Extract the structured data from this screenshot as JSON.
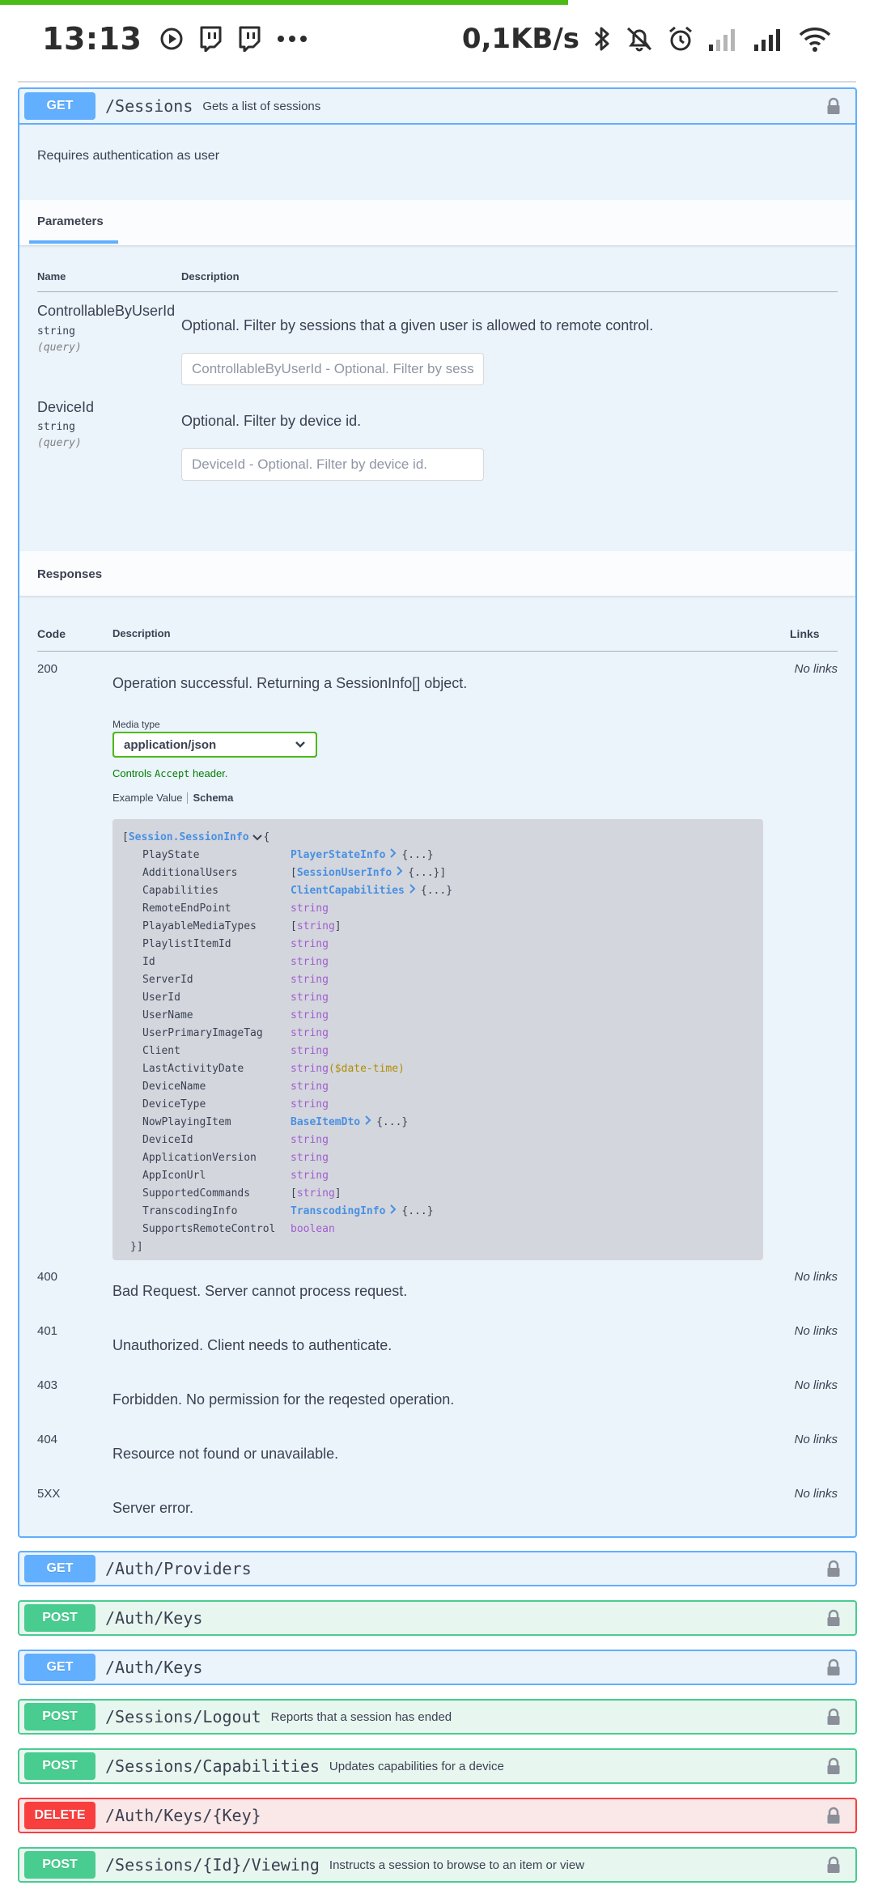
{
  "status_bar": {
    "time": "13:13",
    "net_speed": "0,1KB/s",
    "left_icons": [
      "record-icon",
      "twitch-icon",
      "twitch-icon",
      "more-dots-icon"
    ],
    "right_icons": [
      "bluetooth-icon",
      "muted-bell-icon",
      "alarm-icon",
      "signal-weak-icon",
      "signal-full-icon",
      "wifi-icon"
    ],
    "progress_fraction": 0.65,
    "progress_color": "#4cbb17"
  },
  "colors": {
    "get": "#61affe",
    "post": "#49cc90",
    "delete": "#f93e3e"
  },
  "operation": {
    "method": "GET",
    "path": "/Sessions",
    "summary": "Gets a list of sessions",
    "auth_note": "Requires authentication as user",
    "parameters_tab": "Parameters",
    "col_name": "Name",
    "col_description": "Description",
    "parameters": [
      {
        "name": "ControllableByUserId",
        "type": "string",
        "in": "(query)",
        "description": "Optional. Filter by sessions that a given user is allowed to remote control.",
        "placeholder": "ControllableByUserId - Optional. Filter by sessions that a given user is allowed to remote control."
      },
      {
        "name": "DeviceId",
        "type": "string",
        "in": "(query)",
        "description": "Optional. Filter by device id.",
        "placeholder": "DeviceId - Optional. Filter by device id."
      }
    ],
    "responses_title": "Responses",
    "resp_col_code": "Code",
    "resp_col_description": "Description",
    "resp_col_links": "Links",
    "media_type_label": "Media type",
    "media_type_value": "application/json",
    "controls_note_pre": "Controls",
    "controls_note_code": "Accept",
    "controls_note_post": "header.",
    "example_tab": "Example Value",
    "schema_tab": "Schema",
    "schema": {
      "open": "[",
      "model": "Session.SessionInfo",
      "brace_open": "{",
      "close": "}]",
      "properties": [
        {
          "name": "PlayState",
          "kind": "ref",
          "value": "PlayerStateInfo",
          "suffix": "{...}"
        },
        {
          "name": "AdditionalUsers",
          "kind": "refarray",
          "value": "SessionUserInfo",
          "suffix": "{...}]"
        },
        {
          "name": "Capabilities",
          "kind": "ref",
          "value": "ClientCapabilities",
          "suffix": "{...}"
        },
        {
          "name": "RemoteEndPoint",
          "kind": "type",
          "value": "string"
        },
        {
          "name": "PlayableMediaTypes",
          "kind": "array",
          "value": "string"
        },
        {
          "name": "PlaylistItemId",
          "kind": "type",
          "value": "string"
        },
        {
          "name": "Id",
          "kind": "type",
          "value": "string"
        },
        {
          "name": "ServerId",
          "kind": "type",
          "value": "string"
        },
        {
          "name": "UserId",
          "kind": "type",
          "value": "string"
        },
        {
          "name": "UserName",
          "kind": "type",
          "value": "string"
        },
        {
          "name": "UserPrimaryImageTag",
          "kind": "type",
          "value": "string"
        },
        {
          "name": "Client",
          "kind": "type",
          "value": "string"
        },
        {
          "name": "LastActivityDate",
          "kind": "format",
          "value": "string",
          "format": "($date-time)"
        },
        {
          "name": "DeviceName",
          "kind": "type",
          "value": "string"
        },
        {
          "name": "DeviceType",
          "kind": "type",
          "value": "string"
        },
        {
          "name": "NowPlayingItem",
          "kind": "ref",
          "value": "BaseItemDto",
          "suffix": "{...}"
        },
        {
          "name": "DeviceId",
          "kind": "type",
          "value": "string"
        },
        {
          "name": "ApplicationVersion",
          "kind": "type",
          "value": "string"
        },
        {
          "name": "AppIconUrl",
          "kind": "type",
          "value": "string"
        },
        {
          "name": "SupportedCommands",
          "kind": "array",
          "value": "string"
        },
        {
          "name": "TranscodingInfo",
          "kind": "ref",
          "value": "TranscodingInfo",
          "suffix": "{...}"
        },
        {
          "name": "SupportsRemoteControl",
          "kind": "type",
          "value": "boolean"
        }
      ]
    },
    "responses": [
      {
        "code": "200",
        "description": "Operation successful. Returning a SessionInfo[] object.",
        "links": "No links"
      },
      {
        "code": "400",
        "description": "Bad Request. Server cannot process request.",
        "links": "No links"
      },
      {
        "code": "401",
        "description": "Unauthorized. Client needs to authenticate.",
        "links": "No links"
      },
      {
        "code": "403",
        "description": "Forbidden. No permission for the reqested operation.",
        "links": "No links"
      },
      {
        "code": "404",
        "description": "Resource not found or unavailable.",
        "links": "No links"
      },
      {
        "code": "5XX",
        "description": "Server error.",
        "links": "No links"
      }
    ]
  },
  "other_operations": [
    {
      "method": "GET",
      "path": "/Auth/Providers",
      "summary": ""
    },
    {
      "method": "POST",
      "path": "/Auth/Keys",
      "summary": ""
    },
    {
      "method": "GET",
      "path": "/Auth/Keys",
      "summary": ""
    },
    {
      "method": "POST",
      "path": "/Sessions/Logout",
      "summary": "Reports that a session has ended"
    },
    {
      "method": "POST",
      "path": "/Sessions/Capabilities",
      "summary": "Updates capabilities for a device"
    },
    {
      "method": "DELETE",
      "path": "/Auth/Keys/{Key}",
      "summary": ""
    },
    {
      "method": "POST",
      "path": "/Sessions/{Id}/Viewing",
      "summary": "Instructs a session to browse to an item or view"
    }
  ]
}
